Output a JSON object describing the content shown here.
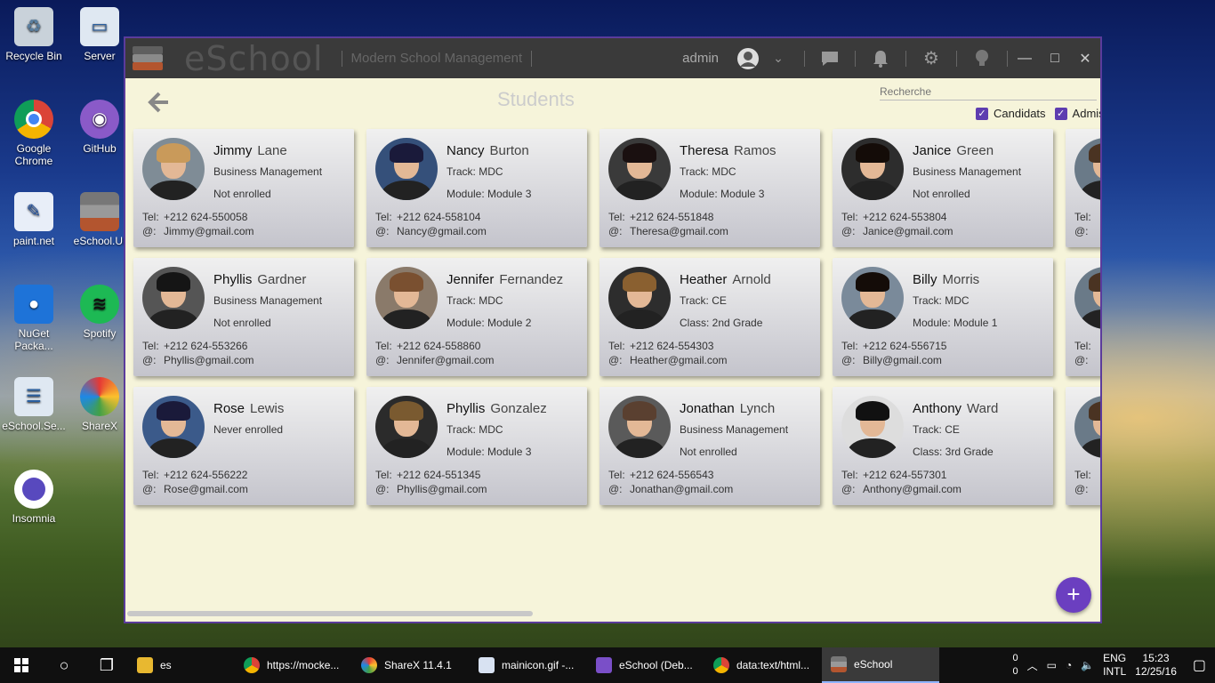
{
  "desktop": {
    "icons": [
      {
        "label": "Recycle Bin"
      },
      {
        "label": "Server"
      },
      {
        "label": "Google Chrome"
      },
      {
        "label": "GitHub"
      },
      {
        "label": "paint.net"
      },
      {
        "label": "eSchool.UI"
      },
      {
        "label": "NuGet Packa..."
      },
      {
        "label": "Spotify"
      },
      {
        "label": "eSchool.Se..."
      },
      {
        "label": "ShareX"
      },
      {
        "label": "Insomnia"
      }
    ]
  },
  "window": {
    "app_name": "eSchool",
    "subtitle": "Modern School Management",
    "user": "admin",
    "page_title": "Students",
    "search_placeholder": "Recherche",
    "filters": [
      {
        "label": "Candidats",
        "checked": true
      },
      {
        "label": "Admis",
        "checked": true
      }
    ],
    "tel_label": "Tel:",
    "mail_label": "@:",
    "fab_label": "+"
  },
  "students": [
    {
      "first": "Jimmy",
      "last": "Lane",
      "line1": "Business Management",
      "line2": "Not enrolled",
      "tel": "+212 624-550058",
      "email": "Jimmy@gmail.com"
    },
    {
      "first": "Nancy",
      "last": "Burton",
      "line1": "Track: MDC",
      "line2": "Module: Module 3",
      "tel": "+212 624-558104",
      "email": "Nancy@gmail.com"
    },
    {
      "first": "Theresa",
      "last": "Ramos",
      "line1": "Track: MDC",
      "line2": "Module: Module 3",
      "tel": "+212 624-551848",
      "email": "Theresa@gmail.com"
    },
    {
      "first": "Janice",
      "last": "Green",
      "line1": "Business Management",
      "line2": "Not enrolled",
      "tel": "+212 624-553804",
      "email": "Janice@gmail.com"
    },
    {
      "first": "Phyllis",
      "last": "Gardner",
      "line1": "Business Management",
      "line2": "Not enrolled",
      "tel": "+212 624-553266",
      "email": "Phyllis@gmail.com"
    },
    {
      "first": "Jennifer",
      "last": "Fernandez",
      "line1": "Track: MDC",
      "line2": "Module: Module 2",
      "tel": "+212 624-558860",
      "email": "Jennifer@gmail.com"
    },
    {
      "first": "Heather",
      "last": "Arnold",
      "line1": "Track: CE",
      "line2": "Class: 2nd Grade",
      "tel": "+212 624-554303",
      "email": "Heather@gmail.com"
    },
    {
      "first": "Billy",
      "last": "Morris",
      "line1": "Track: MDC",
      "line2": "Module: Module 1",
      "tel": "+212 624-556715",
      "email": "Billy@gmail.com"
    },
    {
      "first": "Rose",
      "last": "Lewis",
      "line1": "Never enrolled",
      "line2": "",
      "tel": "+212 624-556222",
      "email": "Rose@gmail.com"
    },
    {
      "first": "Phyllis",
      "last": "Gonzalez",
      "line1": "Track: MDC",
      "line2": "Module: Module 3",
      "tel": "+212 624-551345",
      "email": "Phyllis@gmail.com"
    },
    {
      "first": "Jonathan",
      "last": "Lynch",
      "line1": "Business Management",
      "line2": "Not enrolled",
      "tel": "+212 624-556543",
      "email": "Jonathan@gmail.com"
    },
    {
      "first": "Anthony",
      "last": "Ward",
      "line1": "Track: CE",
      "line2": "Class: 3rd Grade",
      "tel": "+212 624-557301",
      "email": "Anthony@gmail.com"
    }
  ],
  "partial_cards": [
    {
      "tel": "Tel:",
      "mail": "@:"
    },
    {
      "tel": "Tel:",
      "mail": "@:"
    },
    {
      "tel": "Tel:",
      "mail": "@:"
    }
  ],
  "taskbar": {
    "tasks": [
      {
        "label": "es"
      },
      {
        "label": "https://mocke..."
      },
      {
        "label": "ShareX 11.4.1"
      },
      {
        "label": "mainicon.gif -..."
      },
      {
        "label": "eSchool (Deb..."
      },
      {
        "label": "data:text/html..."
      },
      {
        "label": "eSchool"
      }
    ],
    "tray_counts": [
      "0",
      "0"
    ],
    "lang": "ENG",
    "layout": "INTL",
    "time": "15:23",
    "date": "12/25/16"
  },
  "colors": {
    "accent": "#6b3fc0",
    "window_bg": "#f6f4da",
    "titlebar": "#3a3a3a"
  }
}
